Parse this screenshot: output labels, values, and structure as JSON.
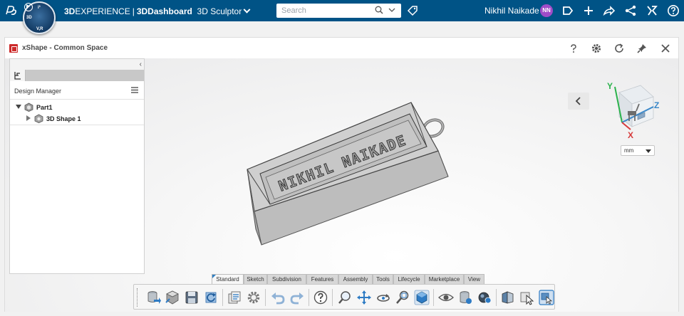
{
  "topbar": {
    "brand_bold1": "3D",
    "brand_light": "EXPERIENCE",
    "brand_sep": "|",
    "brand_bold2": "3DDashboard",
    "brand_app": "3D Sculptor",
    "compass_labels": [
      "3D",
      "V,R",
      "i³"
    ],
    "search_placeholder": "Search",
    "user_name": "Nikhil Naikade",
    "avatar_initials": "NN",
    "bar_color": "#005386",
    "avatar_color": "#9f4cc7"
  },
  "widget": {
    "title": "xShape - Common Space"
  },
  "panel": {
    "header": "Design Manager",
    "tree": [
      {
        "label": "Part1",
        "level": 0,
        "expanded": true
      },
      {
        "label": "3D Shape 1",
        "level": 1,
        "expanded": false
      }
    ]
  },
  "model": {
    "engraved_text": "NIKHIL NAIKADE"
  },
  "compass": {
    "axes": [
      "Y",
      "Z",
      "X"
    ],
    "unit": "mm"
  },
  "action_bar": {
    "tabs": [
      "Standard",
      "Sketch",
      "Subdivision",
      "Features",
      "Assembly",
      "Tools",
      "Lifecycle",
      "Marketplace",
      "View"
    ],
    "active_tab": "Standard"
  }
}
